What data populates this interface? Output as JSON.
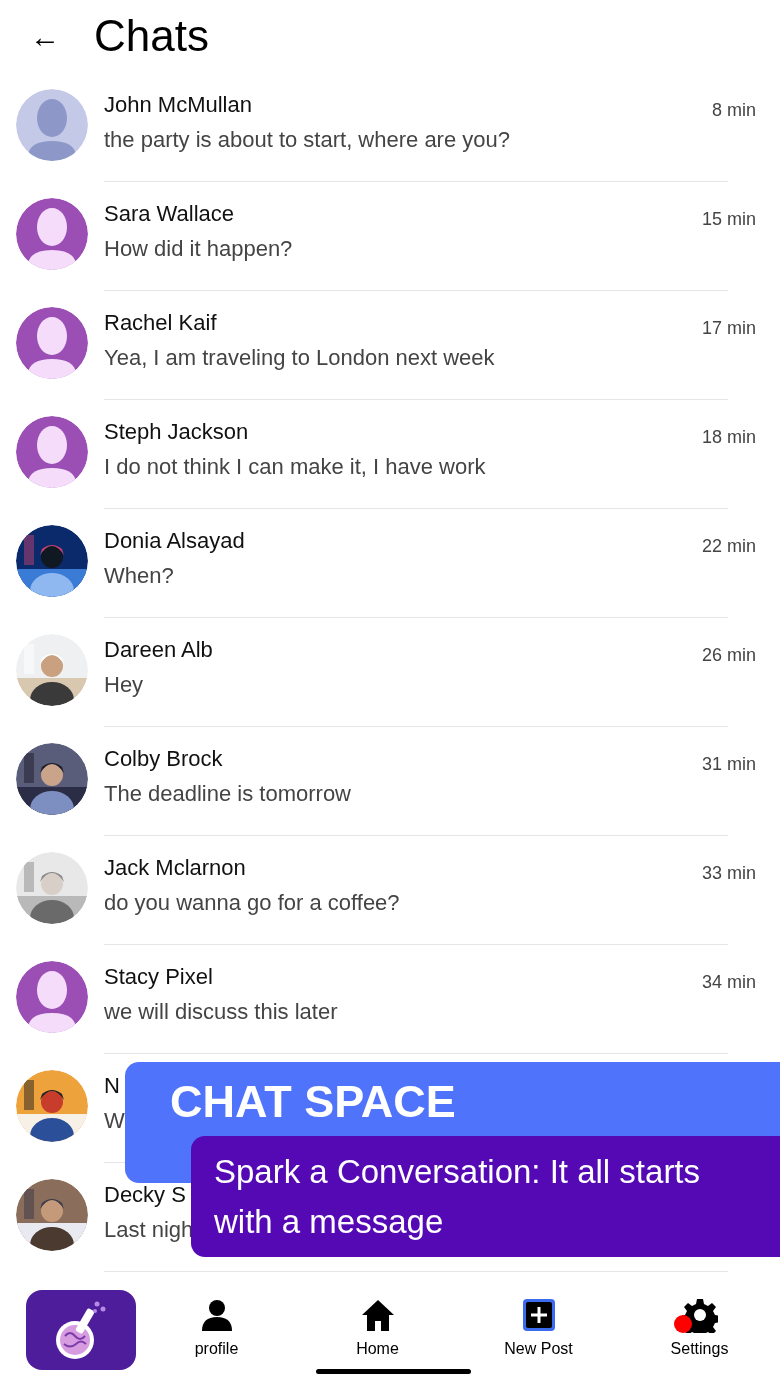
{
  "header": {
    "back": "←",
    "title": "Chats"
  },
  "chats": [
    {
      "name": "John McMullan",
      "message": "the party is about to start, where are you?",
      "time": "8 min",
      "avatar": {
        "kind": "default",
        "color": "#c5c9e8"
      }
    },
    {
      "name": "Sara Wallace",
      "message": "How did it happen?",
      "time": "15 min",
      "avatar": {
        "kind": "default",
        "color": "#9b4fb5"
      }
    },
    {
      "name": "Rachel Kaif",
      "message": "Yea, I am traveling to London next week",
      "time": "17 min",
      "avatar": {
        "kind": "default",
        "color": "#9b4fb5"
      }
    },
    {
      "name": "Steph Jackson",
      "message": "I do not think I can make it, I have work",
      "time": "18 min",
      "avatar": {
        "kind": "default",
        "color": "#9b4fb5"
      }
    },
    {
      "name": "Donia Alsayad",
      "message": "When?",
      "time": "22 min"
    },
    {
      "name": "Dareen Alb",
      "message": "Hey",
      "time": "26 min"
    },
    {
      "name": "Colby Brock",
      "message": "The deadline is tomorrow",
      "time": "31 min"
    },
    {
      "name": "Jack Mclarnon",
      "message": "do you wanna go for a coffee?",
      "time": "33 min"
    },
    {
      "name": "Stacy Pixel",
      "message": "we will discuss this later",
      "time": "34 min",
      "avatar": {
        "kind": "default",
        "color": "#9b4fb5"
      }
    },
    {
      "name": "N",
      "message": "W"
    },
    {
      "name": "Decky S",
      "message": "Last nigh"
    }
  ],
  "banner": {
    "title": "CHAT SPACE",
    "subtitle": "Spark a Conversation: It all starts with a message"
  },
  "nav": [
    {
      "kind": "logo"
    },
    {
      "kind": "profile",
      "label": "profile",
      "notification": false
    },
    {
      "kind": "home",
      "label": "Home",
      "notification": false
    },
    {
      "kind": "new-post",
      "label": "New Post",
      "notification": false
    },
    {
      "kind": "settings",
      "label": "Settings",
      "notification": true
    }
  ]
}
